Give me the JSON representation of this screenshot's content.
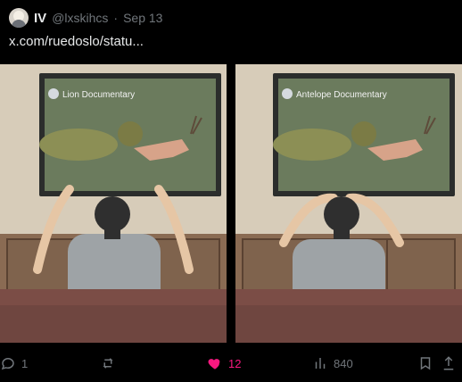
{
  "tweet": {
    "author_name": "IV",
    "handle": "@lxskihcs",
    "separator": "·",
    "date": "Sep 13",
    "text": "x.com/ruedoslo/statu..."
  },
  "media": {
    "panels": [
      {
        "tv_label": "Lion Documentary"
      },
      {
        "tv_label": "Antelope Documentary"
      }
    ]
  },
  "actions": {
    "reply_count": "1",
    "repost_count": "",
    "like_count": "12",
    "views_count": "840"
  },
  "colors": {
    "background": "#000000",
    "text": "#e7e9ea",
    "muted": "#71767b",
    "like_active": "#f91880"
  }
}
